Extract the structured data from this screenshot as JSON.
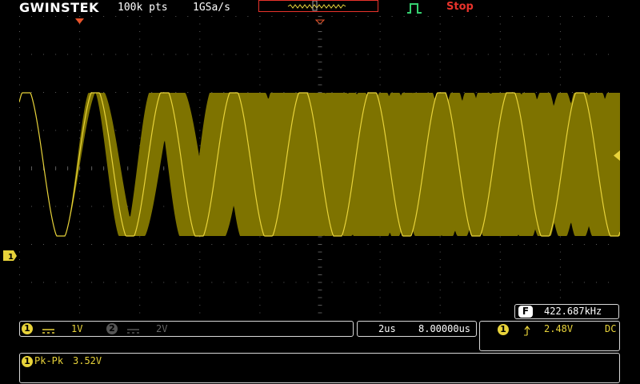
{
  "header": {
    "brand": "GWINSTEK",
    "record_length": "100k pts",
    "sample_rate": "1GSa/s",
    "run_state": "Stop"
  },
  "frequency": {
    "label": "F",
    "value": "422.687kHz"
  },
  "channels": [
    {
      "number": "1",
      "coupling_symbol": "DC",
      "scale": "1V",
      "active": true,
      "color": "#e8d33a"
    },
    {
      "number": "2",
      "scale": "2V",
      "active": false,
      "color": "#666666"
    }
  ],
  "timebase": {
    "scale": "2us",
    "position": "8.00000us"
  },
  "trigger": {
    "source": "1",
    "level": "2.48V",
    "coupling": "DC",
    "slope": "rising"
  },
  "measurement": {
    "source": "1",
    "label": "Pk-Pk",
    "value": "3.52V"
  },
  "ground_marker": "1",
  "colors": {
    "trace": "#e8d33a",
    "grid": "#5a5a5a",
    "stop": "#e8332b"
  }
}
